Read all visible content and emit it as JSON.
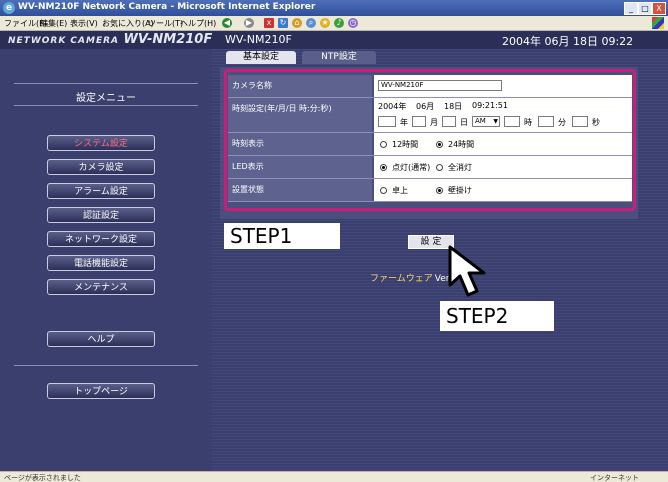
{
  "window": {
    "title": "WV-NM210F Network Camera - Microsoft Internet Explorer",
    "controls": [
      "_",
      "□",
      "X"
    ]
  },
  "menubar": {
    "items": [
      "ファイル(F)",
      "編集(E)",
      "表示(V)",
      "お気に入り(A)",
      "ツール(T)",
      "ヘルプ(H)"
    ]
  },
  "header": {
    "logo": "NETWORK CAMERA",
    "model_large": "WV-NM210F",
    "model": "WV-NM210F",
    "datetime": "2004年 06月 18日 09:22"
  },
  "sidebar": {
    "title": "設定メニュー",
    "items": [
      {
        "label": "システム設定",
        "active": true
      },
      {
        "label": "カメラ設定"
      },
      {
        "label": "アラーム設定"
      },
      {
        "label": "認証設定"
      },
      {
        "label": "ネットワーク設定"
      },
      {
        "label": "電話機能設定"
      },
      {
        "label": "メンテナンス"
      }
    ],
    "help": "ヘルプ",
    "top": "トップページ"
  },
  "tabs": [
    {
      "label": "基本設定",
      "active": true
    },
    {
      "label": "NTP設定"
    }
  ],
  "settings": {
    "camera_name": {
      "label": "カメラ名称",
      "value": "WV-NM210F"
    },
    "clock": {
      "label": "時刻設定(年/月/日 時:分:秒)",
      "current": [
        "2004年",
        "06月",
        "18日",
        "09:21:51"
      ],
      "year_unit": "年",
      "month_unit": "月",
      "day_unit": "日",
      "ampm_value": "AM",
      "hour_unit": "時",
      "min_unit": "分",
      "sec_unit": "秒"
    },
    "time_display": {
      "label": "時刻表示",
      "options": [
        "12時間",
        "24時間"
      ],
      "selected": 1
    },
    "led": {
      "label": "LED表示",
      "options": [
        "点灯(通常)",
        "全消灯"
      ],
      "selected": 0
    },
    "install": {
      "label": "設置状態",
      "options": [
        "卓上",
        "壁掛け"
      ],
      "selected": 1
    }
  },
  "set_button": "設 定",
  "firmware": {
    "label": "ファームウェア",
    "version": "Ver"
  },
  "steps": [
    "STEP1",
    "STEP2"
  ],
  "statusbar": {
    "left": "ページが表示されました",
    "right": "インターネット"
  },
  "colors": {
    "highlight_box": "#c8207a",
    "active_menu": "#ff6c84",
    "background": "#3a3f6e"
  }
}
